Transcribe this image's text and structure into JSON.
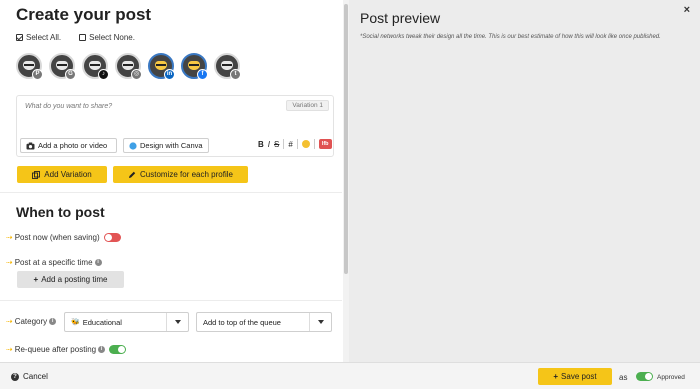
{
  "composer_panel": {
    "title": "Create your post",
    "select_all": "Select All.",
    "select_none": "Select None.",
    "profiles": [
      {
        "name": "profile-1",
        "network": "pinterest-icon",
        "badge": "P",
        "badge_color": "#777777",
        "selected": false,
        "face": "light"
      },
      {
        "name": "profile-2",
        "network": "gmb-icon",
        "badge": "G",
        "badge_color": "#777777",
        "selected": false,
        "face": "light"
      },
      {
        "name": "profile-3",
        "network": "tiktok-icon",
        "badge": "♪",
        "badge_color": "#111111",
        "selected": false,
        "face": "light"
      },
      {
        "name": "profile-4",
        "network": "instagram-icon",
        "badge": "◎",
        "badge_color": "#777777",
        "selected": false,
        "face": "light"
      },
      {
        "name": "profile-5",
        "network": "linkedin-icon",
        "badge": "in",
        "badge_color": "#0a66c2",
        "selected": true,
        "face": "yellow"
      },
      {
        "name": "profile-6",
        "network": "facebook-icon",
        "badge": "f",
        "badge_color": "#1877f2",
        "selected": true,
        "face": "yellow"
      },
      {
        "name": "profile-7",
        "network": "twitter-icon",
        "badge": "t",
        "badge_color": "#777777",
        "selected": false,
        "face": "light"
      }
    ],
    "text_placeholder": "What do you want to share?",
    "variation_label": "Variation 1",
    "add_photo_label": "Add a photo or video",
    "canva_label": "Design with Canva",
    "format": {
      "bold": "B",
      "italic": "I",
      "strike": "S",
      "hashtag": "#",
      "lfb_label": "lfb"
    },
    "add_variation_label": "Add Variation",
    "customize_label": "Customize for each profile"
  },
  "when_to_post": {
    "heading": "When to post",
    "post_now_label": "Post now (when saving)",
    "post_now_enabled": false,
    "specific_time_label": "Post at a specific time",
    "add_time_label": "Add a posting time",
    "category_label": "Category",
    "category_value": "Educational",
    "queue_position_value": "Add to top of the queue",
    "requeue_label": "Re-queue after posting",
    "requeue_enabled": true
  },
  "preview_panel": {
    "title": "Post preview",
    "note": "*Social networks tweak their design all the time. This is our best estimate of how this will look like once published.",
    "close_symbol": "×"
  },
  "footer": {
    "cancel_label": "Cancel",
    "save_label": "Save post",
    "as_label": "as",
    "status_label": "Approved",
    "approved_enabled": true
  },
  "colors": {
    "accent_yellow": "#f5c518",
    "toggle_on": "#4caf50",
    "toggle_off": "#e25555",
    "preview_bg": "#ececec"
  }
}
